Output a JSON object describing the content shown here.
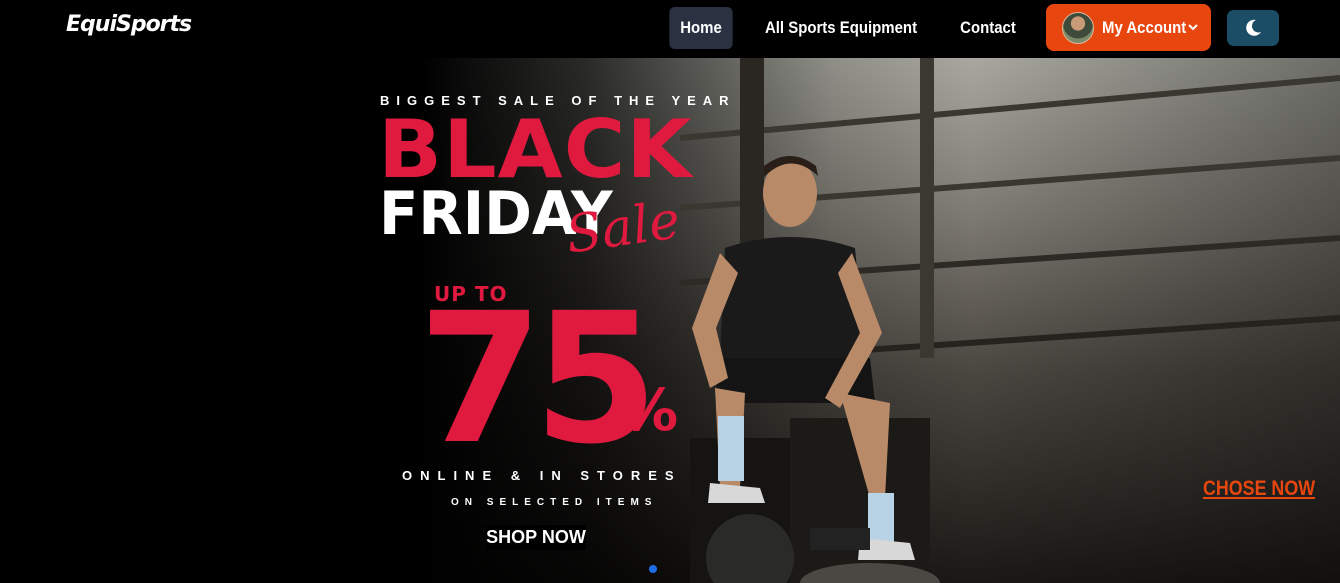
{
  "nav": {
    "logo": "EquiSports",
    "links": [
      "Home",
      "All Sports Equipment",
      "Contact"
    ],
    "active": "Home",
    "account_label": "My Account",
    "account_color": "#e8460f",
    "theme_icon": "moon-icon"
  },
  "hero": {
    "tagline": "BIGGEST SALE OF THE YEAR",
    "headline_1": "BLACK",
    "headline_2": "FRIDAY",
    "script_word": "Sale",
    "upto": "UP TO",
    "discount_number": "75",
    "discount_sign": "%",
    "online": "ONLINE & IN STORES",
    "selected": "ON SELECTED ITEMS",
    "shop_button": "SHOP NOW",
    "cta_link": "CHOSE NOW",
    "accent_red": "#e0193f",
    "slider_dots": 1
  }
}
